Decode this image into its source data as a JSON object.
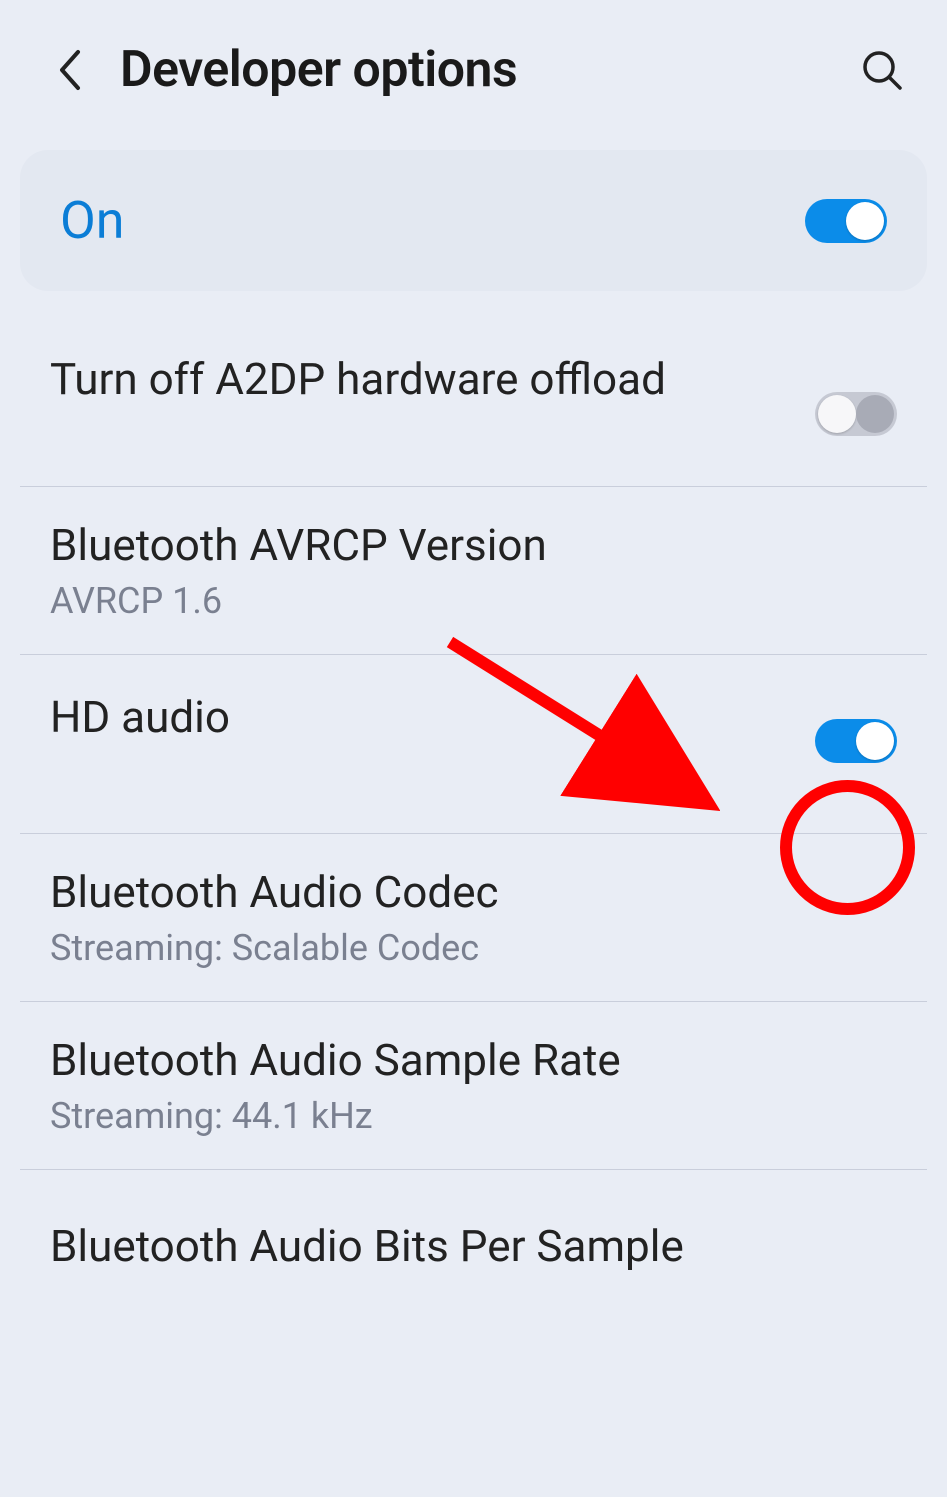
{
  "header": {
    "title": "Developer options"
  },
  "master": {
    "label": "On",
    "state": "on"
  },
  "items": [
    {
      "title": "Turn off A2DP hardware offload",
      "sub": "",
      "toggle": "off"
    },
    {
      "title": "Bluetooth AVRCP Version",
      "sub": "AVRCP 1.6",
      "toggle": null
    },
    {
      "title": "HD audio",
      "sub": "",
      "toggle": "on"
    },
    {
      "title": "Bluetooth Audio Codec",
      "sub": "Streaming: Scalable Codec",
      "toggle": null
    },
    {
      "title": "Bluetooth Audio Sample Rate",
      "sub": "Streaming: 44.1 kHz",
      "toggle": null
    },
    {
      "title": "Bluetooth Audio Bits Per Sample",
      "sub": "",
      "toggle": null
    }
  ],
  "colors": {
    "accent": "#0b8ce9",
    "annotation": "#ff0000"
  }
}
